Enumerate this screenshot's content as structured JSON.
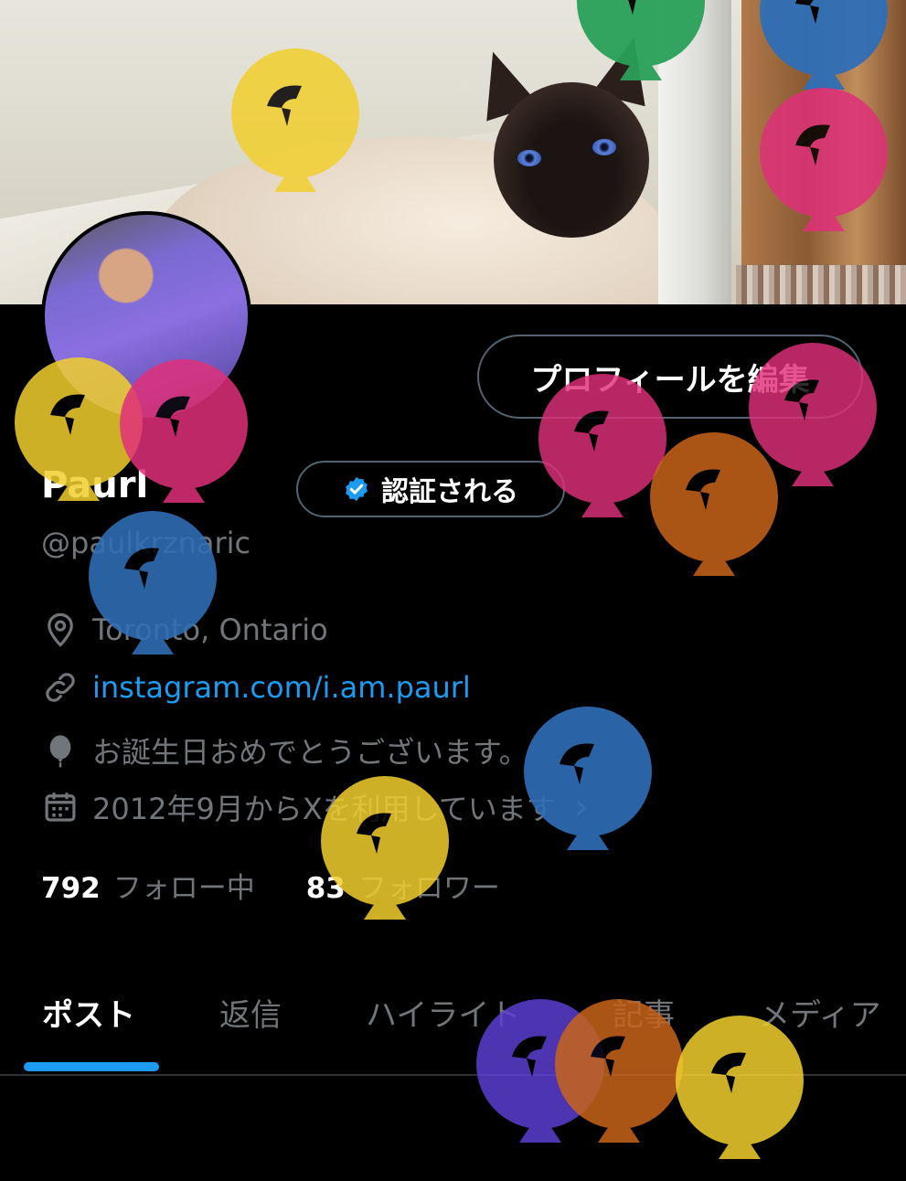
{
  "profile": {
    "name": "Paurl",
    "handle": "@paulkrznaric",
    "location": "Toronto, Ontario",
    "website": "instagram.com/i.am.paurl",
    "birthday_text": "お誕生日おめでとうございます。",
    "joined_text": "2012年9月からXを利用しています",
    "joined_chevron": "›"
  },
  "buttons": {
    "edit_profile": "プロフィールを編集",
    "verified": "認証される"
  },
  "stats": {
    "following_count": "792",
    "following_label": "フォロー中",
    "followers_count": "83",
    "followers_label": "フォロワー"
  },
  "tabs": [
    {
      "label": "ポスト",
      "active": true
    },
    {
      "label": "返信",
      "active": false
    },
    {
      "label": "ハイライト",
      "active": false
    },
    {
      "label": "記事",
      "active": false
    },
    {
      "label": "メディア",
      "active": false
    }
  ],
  "icons": {
    "location": "location-pin-icon",
    "link": "link-icon",
    "birthday": "balloon-icon",
    "joined": "calendar-icon",
    "verified": "verified-badge-icon"
  },
  "colors": {
    "background": "#000000",
    "accent": "#1d9bf0",
    "muted_text": "#71767b",
    "border": "#536471",
    "balloon_yellow": "#f2cf2e",
    "balloon_pink": "#e0307a",
    "balloon_blue": "#2f6fb8",
    "balloon_orange": "#c8641a",
    "balloon_green": "#2aa05a",
    "balloon_purple": "#5b3fd0"
  }
}
